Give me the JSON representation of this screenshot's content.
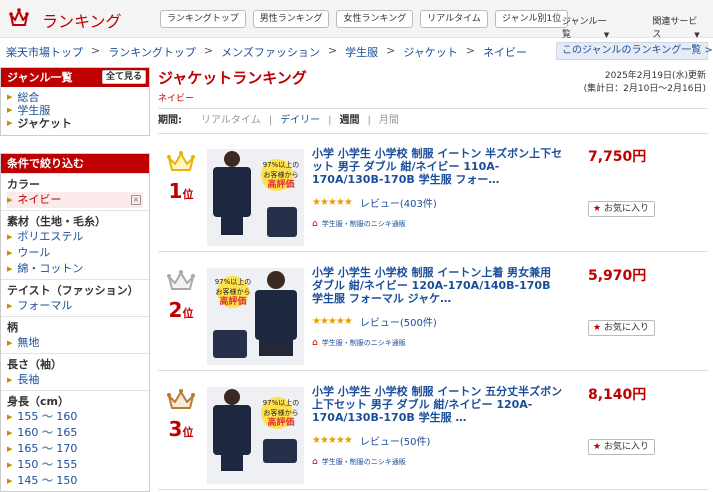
{
  "header": {
    "logo_text": "ランキング",
    "nav": [
      "ランキングトップ",
      "男性ランキング",
      "女性ランキング",
      "リアルタイム",
      "ジャンル別1位"
    ],
    "links": [
      "ジャンル一覧",
      "関連サービス"
    ]
  },
  "breadcrumb": [
    "楽天市場トップ",
    "ランキングトップ",
    "メンズファッション",
    "学生服",
    "ジャケット",
    "ネイビー"
  ],
  "genre_rank_link": "このジャンルのランキング一覧 >>",
  "sidebar": {
    "genre_head": "ジャンル一覧",
    "show_all": "全て見る",
    "genres": [
      "総合",
      "学生服",
      "ジャケット"
    ],
    "filter_head": "条件で絞り込む",
    "sections": [
      {
        "title": "カラー",
        "options": [
          "ネイビー"
        ]
      },
      {
        "title": "素材（生地・毛糸）",
        "options": [
          "ポリエステル",
          "ウール",
          "綿・コットン"
        ]
      },
      {
        "title": "テイスト（ファッション）",
        "options": [
          "フォーマル"
        ]
      },
      {
        "title": "柄",
        "options": [
          "無地"
        ]
      },
      {
        "title": "長さ（袖）",
        "options": [
          "長袖"
        ]
      },
      {
        "title": "身長（cm）",
        "options": [
          "155 ～ 160",
          "160 ～ 165",
          "165 ～ 170",
          "150 ～ 155",
          "145 ～ 150"
        ]
      }
    ]
  },
  "main": {
    "title": "ジャケットランキング",
    "subtitle": "ネイビー",
    "updated_line1": "2025年2月19日(水)更新",
    "updated_line2": "(集計日：2月10日～2月16日)",
    "period_label": "期間:",
    "periods": [
      "リアルタイム",
      "デイリー",
      "週間",
      "月間"
    ]
  },
  "items": [
    {
      "rank": "1",
      "rank_suffix": "位",
      "title": "小学 小学生 小学校 制服 イートン 半ズボン上下セット 男子 ダブル 紺/ネイビー 110A-170A/130B-170B 学生服 フォー…",
      "stars": "★★★★★",
      "review": "レビュー(403件)",
      "shop": "学生服・制服のニシキ通販",
      "price": "7,750円",
      "fav": "お気に入り",
      "badge_line1": "97%以上の",
      "badge_line2": "お客様から",
      "badge_line3": "高評価"
    },
    {
      "rank": "2",
      "rank_suffix": "位",
      "title": "小学 小学生 小学校 制服 イートン上着 男女兼用 ダブル 紺/ネイビー 120A-170A/140B-170B 学生服 フォーマル ジャケ…",
      "stars": "★★★★★",
      "review": "レビュー(500件)",
      "shop": "学生服・制服のニシキ通販",
      "price": "5,970円",
      "fav": "お気に入り",
      "badge_line1": "97%以上の",
      "badge_line2": "お客様から",
      "badge_line3": "高評価"
    },
    {
      "rank": "3",
      "rank_suffix": "位",
      "title": "小学 小学生 小学校 制服 イートン 五分丈半ズボン上下セット 男子 ダブル 紺/ネイビー 120A-170A/130B-170B 学生服 …",
      "stars": "★★★★★",
      "review": "レビュー(50件)",
      "shop": "学生服・制服のニシキ通販",
      "price": "8,140円",
      "fav": "お気に入り",
      "badge_line1": "97%以上の",
      "badge_line2": "お客様から",
      "badge_line3": "高評価"
    }
  ],
  "colors": {
    "brand_red": "#bf0000",
    "link_blue": "#1a4e9a",
    "gold": "#e8b400",
    "silver": "#a9a9a9",
    "bronze": "#b87a33"
  }
}
